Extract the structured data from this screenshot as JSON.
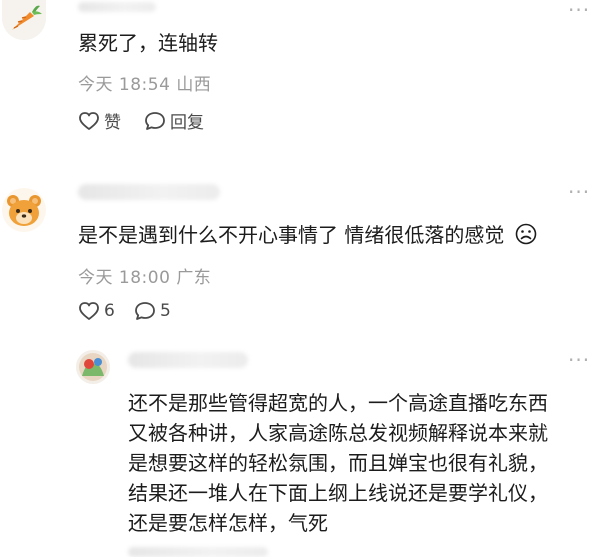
{
  "comments": [
    {
      "text": "累死了，连轴转",
      "time": "今天 18:54",
      "location": "山西",
      "like_label": "赞",
      "reply_label": "回复"
    },
    {
      "text": "是不是遇到什么不开心事情了 情绪很低落的感觉",
      "emoji": "sad-face",
      "time": "今天 18:00",
      "location": "广东",
      "like_count": "6",
      "reply_count": "5"
    }
  ],
  "reply": {
    "lines": [
      "还不是那些管得超宽的人，一个高途直播吃东西",
      "又被各种讲，人家高途陈总发视频解释说本来就",
      "是想要这样的轻松氛围，而且婵宝也很有礼貌，",
      "结果还一堆人在下面上纲上线说还是要学礼仪，",
      "还是要怎样怎样，气死"
    ]
  },
  "more_icon": "more-dots-icon"
}
